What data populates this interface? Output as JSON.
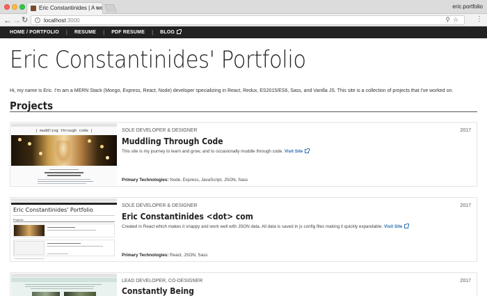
{
  "browser": {
    "tab_title": "Eric Constantinides | A web ap",
    "profile_name": "eric.portfolio",
    "url_host": "localhost",
    "url_port": ":3000"
  },
  "nav": {
    "items": [
      {
        "label": "HOME / PORTFOLIO"
      },
      {
        "label": "RESUME"
      },
      {
        "label": "PDF RESUME"
      },
      {
        "label": "BLOG"
      }
    ]
  },
  "page": {
    "title": "Eric Constantinides' Portfolio",
    "intro": "Hi, my name is Eric. I'm am a MERN Stack (Mongo, Express, React, Node) developer specializing in React, Redux, ES2015/ES6, Sass, and Vanilla JS. This site is a collection of projects that I've worked on.",
    "projects_heading": "Projects"
  },
  "projects": [
    {
      "role": "SOLE DEVELOPER & DESIGNER",
      "year": "2017",
      "title": "Muddling Through Code",
      "description": "This site is my journey to learn and grow, and to occasionally muddle through code.",
      "link_label": "Visit Site",
      "tech_label": "Primary Technologies:",
      "tech": "Node, Express, JavaScript, JSON, Sass",
      "thumb_caption": "| muddling through code |"
    },
    {
      "role": "SOLE DEVELOPER & DESIGNER",
      "year": "2017",
      "title": "Eric Constantinides <dot> com",
      "description": "Created in React which makes it snappy and work well with JSON data. All data is saved in js config files making it quickly expandable.",
      "link_label": "Visit Site",
      "tech_label": "Primary Technologies:",
      "tech": "React, JSON, Sass",
      "thumb_caption": "Eric Constantinides' Portfolio"
    },
    {
      "role": "LEAD DEVELOPER, CO-DESIGNER",
      "year": "2017",
      "title": "Constantly Being"
    }
  ]
}
